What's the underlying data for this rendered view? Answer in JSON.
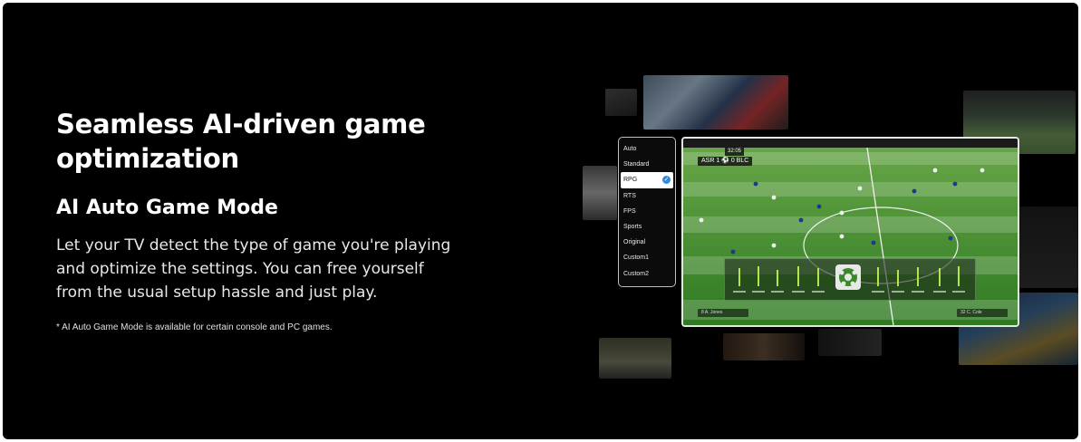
{
  "hero": {
    "title_line1": "Seamless AI-driven game",
    "title_line2": "optimization",
    "subtitle": "AI Auto Game Mode",
    "body_line1": "Let your TV detect the type of game you're playing",
    "body_line2": "and optimize the settings. You can free yourself",
    "body_line3": "from the usual setup hassle and just play.",
    "footnote": "* AI Auto Game Mode is available for certain console and PC games."
  },
  "game_mode_menu": {
    "items": [
      "Auto",
      "Standard",
      "RPG",
      "RTS",
      "FPS",
      "Sports",
      "Original",
      "Custom1",
      "Custom2"
    ],
    "selected": "RPG",
    "check_icon": "check-icon"
  },
  "game_screen": {
    "clock": "32:05",
    "scoreboard": "ASR   1 ⚽ 0   BLC",
    "left_player": "8    A. Jones",
    "right_player": "32    C. Cole",
    "center_icon": "soccer-ball-icon"
  },
  "colors": {
    "background": "#000000",
    "text": "#ffffff",
    "accent": "#2b8ae6",
    "pitch": "#3e8a2f"
  }
}
